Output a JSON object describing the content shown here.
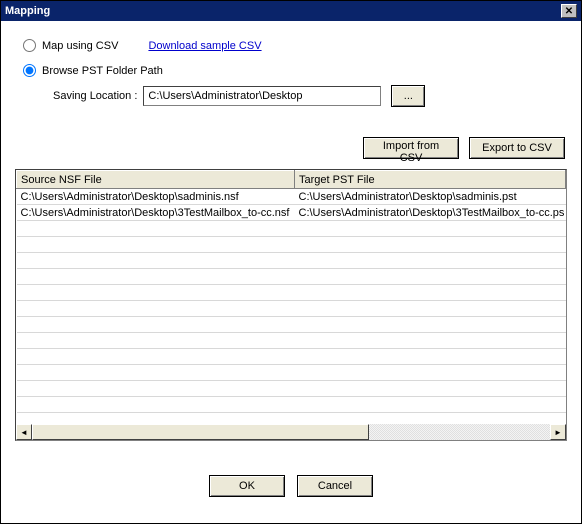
{
  "title": "Mapping",
  "options": {
    "csv": {
      "label": "Map using CSV",
      "checked": false
    },
    "browse": {
      "label": "Browse PST Folder Path",
      "checked": true
    },
    "download_link": "Download sample CSV"
  },
  "saving": {
    "label": "Saving Location :",
    "value": "C:\\Users\\Administrator\\Desktop",
    "browse_label": "..."
  },
  "buttons": {
    "import_csv": "Import from CSV",
    "export_csv": "Export to CSV",
    "ok": "OK",
    "cancel": "Cancel"
  },
  "table": {
    "headers": {
      "source": "Source NSF File",
      "target": "Target PST File"
    },
    "rows": [
      {
        "source": "C:\\Users\\Administrator\\Desktop\\sadminis.nsf",
        "target": "C:\\Users\\Administrator\\Desktop\\sadminis.pst"
      },
      {
        "source": "C:\\Users\\Administrator\\Desktop\\3TestMailbox_to-cc.nsf",
        "target": "C:\\Users\\Administrator\\Desktop\\3TestMailbox_to-cc.ps"
      }
    ]
  }
}
